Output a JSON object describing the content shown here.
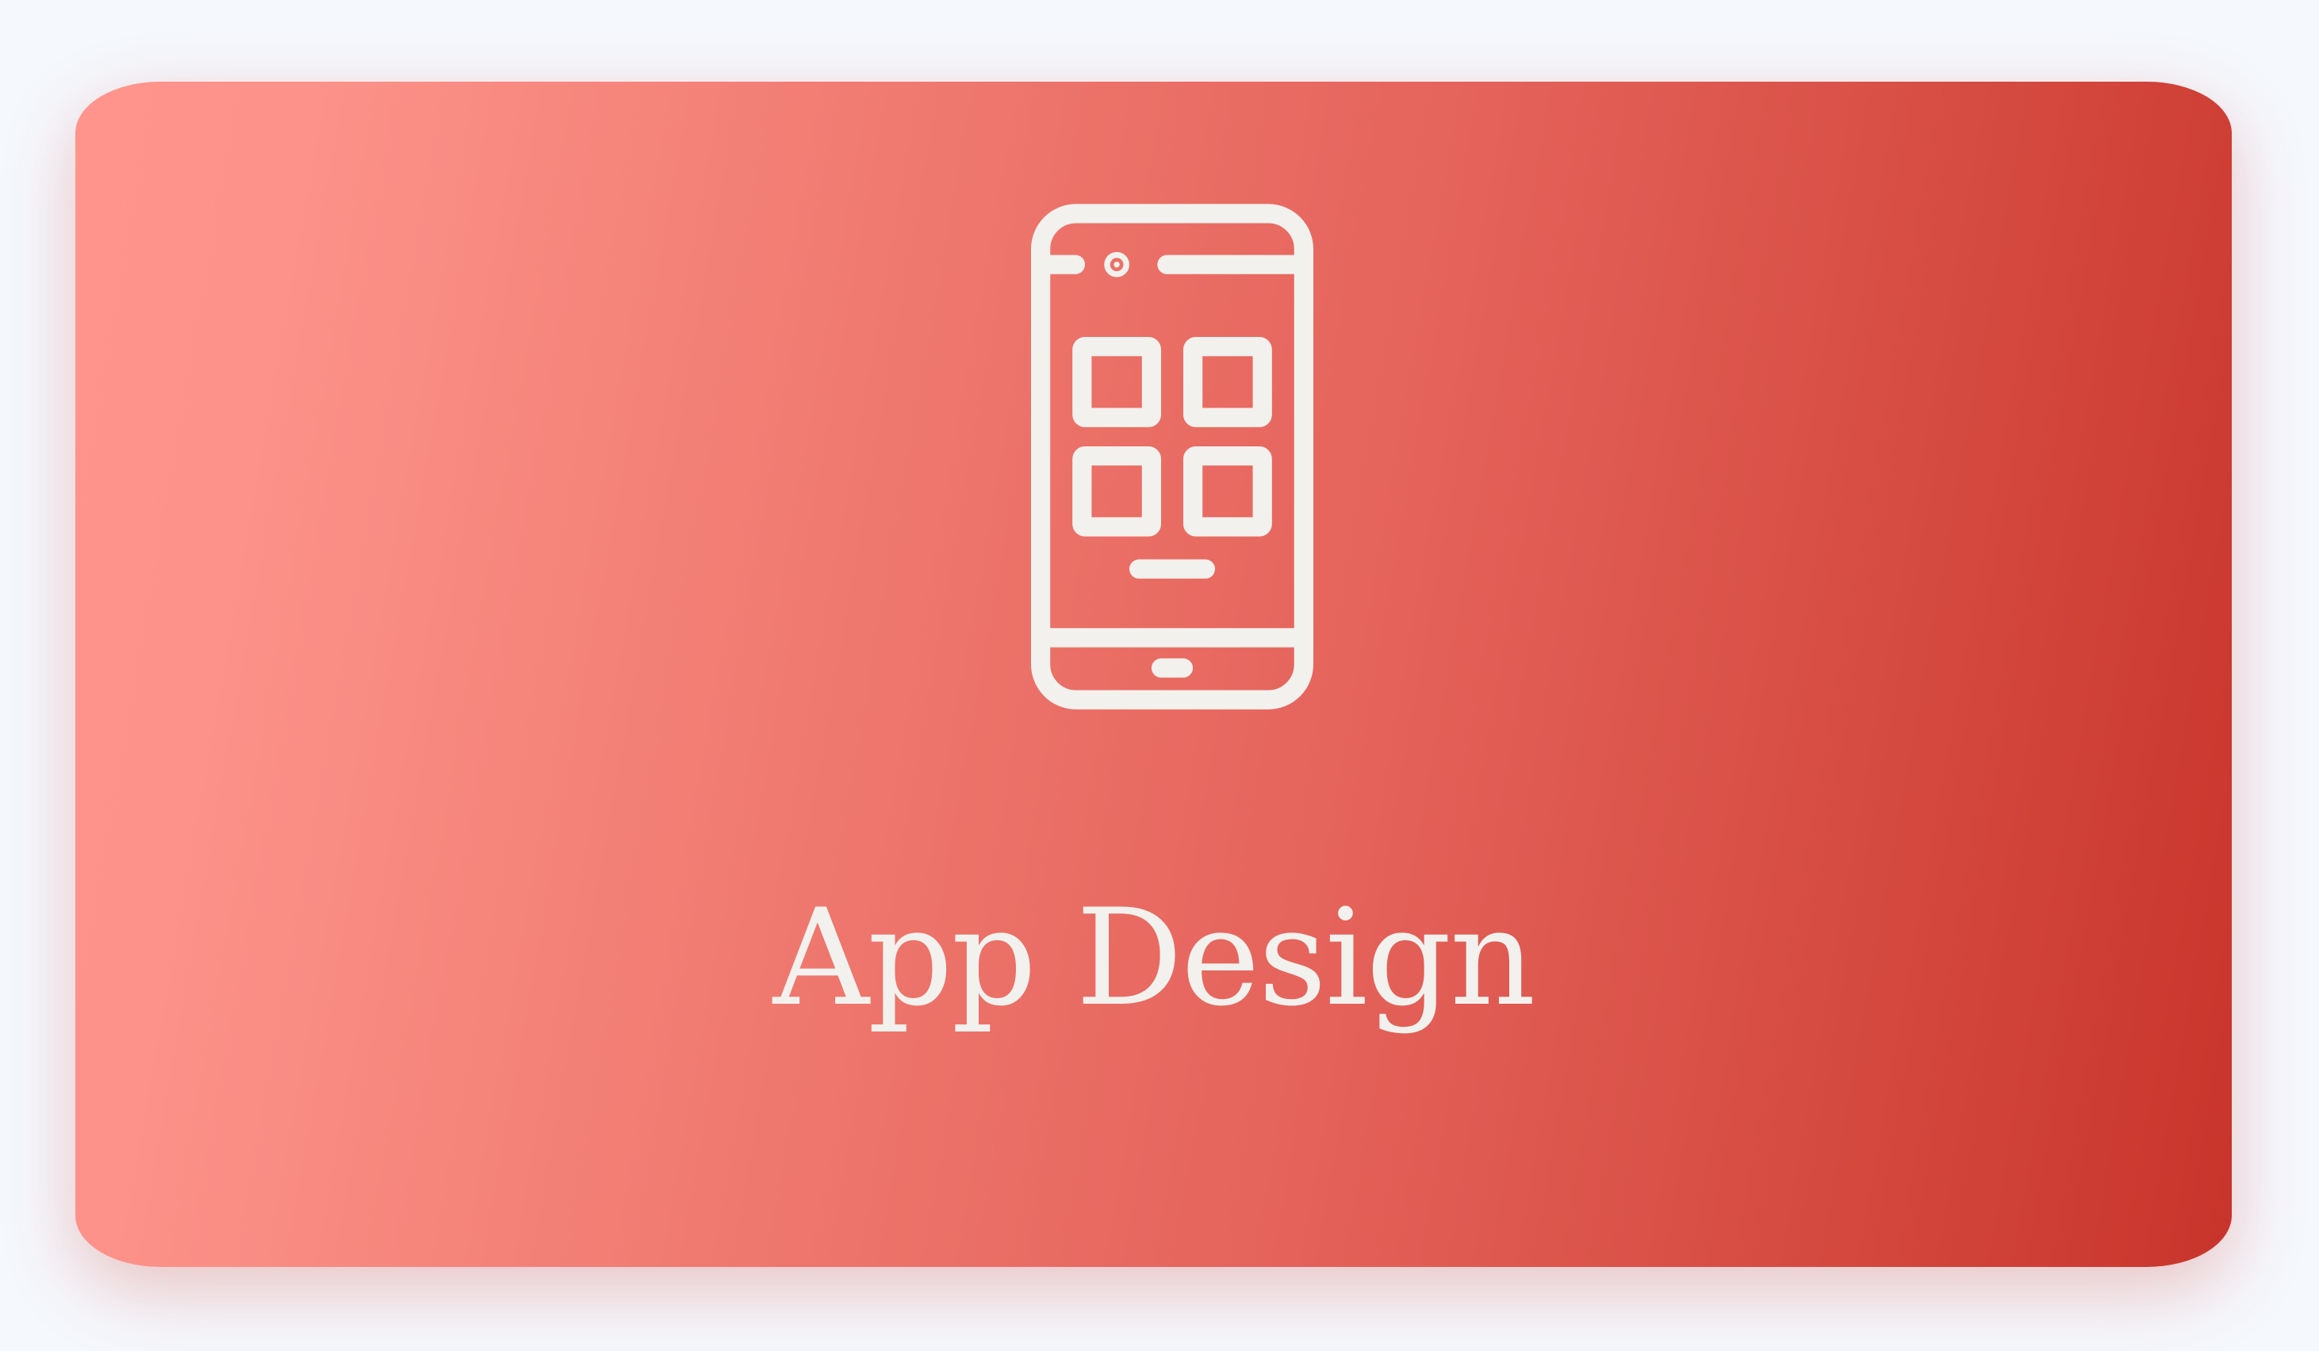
{
  "card": {
    "title": "App Design",
    "icon": "mobile-app-icon",
    "colors": {
      "gradient_start": "#ff948c",
      "gradient_end": "#c8342b",
      "foreground": "#f3f1ee",
      "background": "#f5f8fd"
    }
  }
}
